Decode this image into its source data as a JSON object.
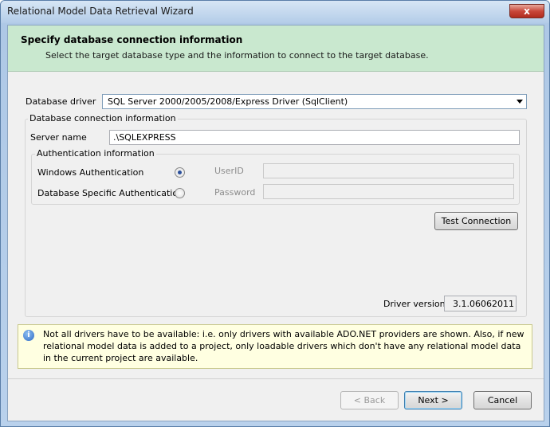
{
  "window": {
    "title": "Relational Model Data Retrieval Wizard",
    "close_glyph": "x"
  },
  "header": {
    "title": "Specify database connection information",
    "subtitle": "Select the target database type and the information to connect to the target database."
  },
  "driver": {
    "label": "Database driver",
    "selected": "SQL Server 2000/2005/2008/Express Driver (SqlClient)"
  },
  "connection": {
    "group_title": "Database connection information",
    "server_label": "Server name",
    "server_value": ".\\SQLEXPRESS",
    "auth": {
      "group_title": "Authentication information",
      "windows_label": "Windows Authentication",
      "windows_selected": true,
      "db_label": "Database Specific Authentication",
      "db_selected": false,
      "userid_label": "UserID",
      "userid_value": "",
      "password_label": "Password",
      "password_value": ""
    },
    "test_button": "Test Connection",
    "driver_version_label": "Driver version",
    "driver_version_value": "3.1.06062011"
  },
  "info": {
    "icon": "info-icon",
    "text": "Not all drivers have to be available: i.e. only drivers with available ADO.NET providers are shown. Also, if new relational model data is added to a project, only loadable drivers which don't have any relational model data in the current project are available."
  },
  "footer": {
    "back_button": "< Back",
    "next_button": "Next >",
    "cancel_button": "Cancel"
  }
}
